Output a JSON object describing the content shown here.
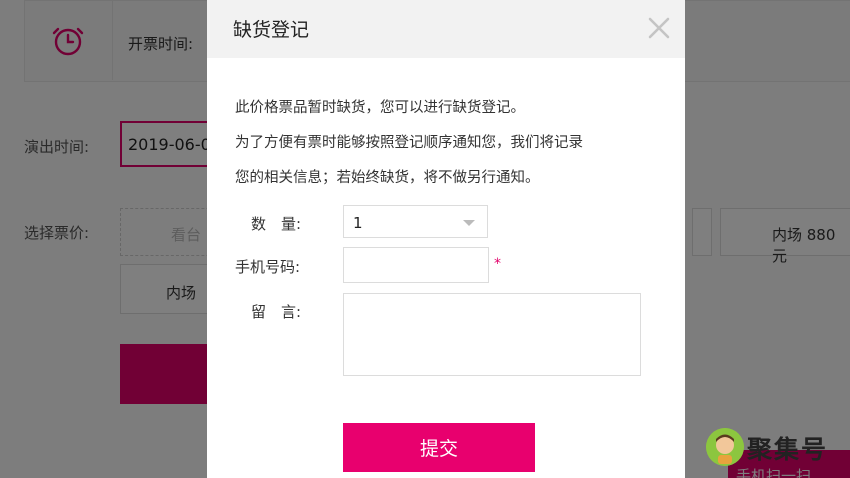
{
  "background": {
    "ticket_time_label": "开票时间:",
    "show_time_label": "演出时间:",
    "show_date_value": "2019-06-0",
    "price_label": "选择票价:",
    "price_options": [
      {
        "label": "看台"
      },
      {
        "label": "内场 880元"
      },
      {
        "label": "内场"
      }
    ],
    "scan_label": "手机扫一扫"
  },
  "modal": {
    "title": "缺货登记",
    "notice_lines": [
      "此价格票品暂时缺货，您可以进行缺货登记。",
      "为了方便有票时能够按照登记顺序通知您，我们将记录",
      "您的相关信息；若始终缺货，将不做另行通知。"
    ],
    "form": {
      "quantity_label": "数　量:",
      "quantity_value": "1",
      "phone_label": "手机号码:",
      "phone_placeholder": "",
      "required_mark": "*",
      "message_label": "留　言:",
      "message_placeholder": ""
    },
    "submit_label": "提交"
  },
  "watermark": {
    "text": "聚集号"
  },
  "colors": {
    "accent": "#e2006a",
    "overlay": "rgba(0,0,0,0.5)"
  },
  "icons": {
    "clock": "clock-icon",
    "close": "close-icon",
    "dropdown": "chevron-down-icon"
  }
}
